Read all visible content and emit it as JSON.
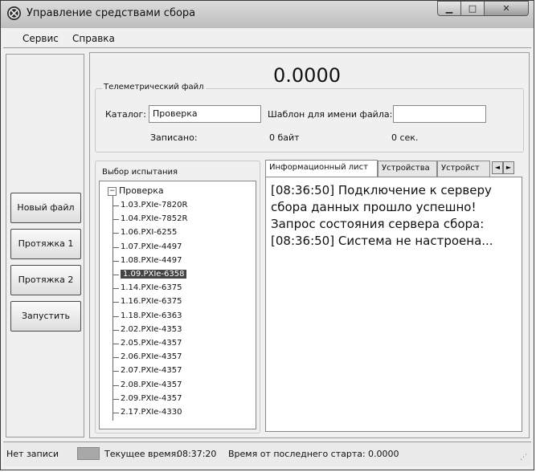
{
  "window": {
    "title": "Управление средствами сбора"
  },
  "menu": {
    "items": [
      "Сервис",
      "Справка"
    ]
  },
  "sidebar": {
    "buttons": [
      "Новый файл",
      "Протяжка 1",
      "Протяжка 2",
      "Запустить"
    ]
  },
  "main": {
    "elapsed": "0.0000",
    "telemetry": {
      "legend": "Телеметрический файл",
      "catalog_label": "Каталог:",
      "catalog_value": "Проверка",
      "template_label": "Шаблон для имени файла:",
      "template_value": "",
      "written_label": "Записано:",
      "written_value": "0 байт",
      "time_value": "0 сек."
    },
    "test_selection": {
      "legend": "Выбор испытания",
      "root": "Проверка",
      "root_expander": "−",
      "selected_index": 5,
      "items": [
        "1.03.PXIe-7820R",
        "1.04.PXIe-7852R",
        "1.06.PXI-6255",
        "1.07.PXIe-4497",
        "1.08.PXIe-4497",
        "1.09.PXIe-6358",
        "1.14.PXIe-6375",
        "1.16.PXIe-6375",
        "1.18.PXIe-6363",
        "2.02.PXIe-4353",
        "2.05.PXIe-4357",
        "2.06.PXIe-4357",
        "2.07.PXIe-4357",
        "2.08.PXIe-4357",
        "2.09.PXIe-4357",
        "2.17.PXIe-4330"
      ]
    },
    "tabs": [
      "Информационный лист",
      "Устройства",
      "Устройст"
    ],
    "log_lines": [
      "[08:36:50] Подключение к серверу сбора данных прошло успешно!",
      "Запрос состояния сервера сбора:",
      "[08:36:50] Система не настроена..."
    ]
  },
  "status": {
    "record": "Нет записи",
    "current_time_label": "Текущее время:",
    "current_time": "08:37:20",
    "since_start_label": "Время от последнего старта:",
    "since_start": "0.0000"
  },
  "colors": {
    "selection": "#444444",
    "window_bg": "#f0f0f0"
  }
}
